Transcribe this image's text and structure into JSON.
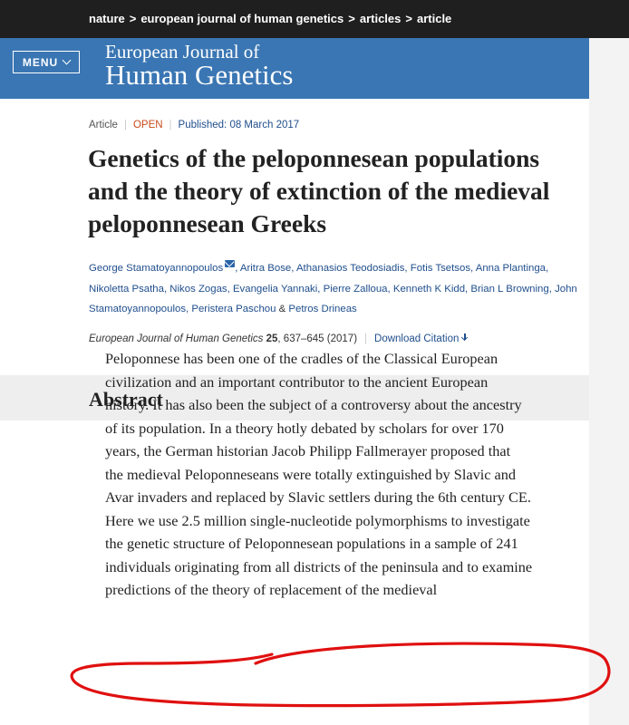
{
  "breadcrumb": {
    "items": [
      "nature",
      "european journal of human genetics",
      "articles",
      "article"
    ],
    "separator": ">"
  },
  "header": {
    "menu_label": "MENU",
    "journal_line1": "European Journal of",
    "journal_line2": "Human Genetics"
  },
  "article": {
    "type": "Article",
    "access": "OPEN",
    "published": "Published: 08 March 2017",
    "title": "Genetics of the peloponnesean populations and the theory of extinction of the medieval peloponnesean Greeks",
    "authors": [
      "George Stamatoyannopoulos",
      "Aritra Bose",
      "Athanasios Teodosiadis",
      "Fotis Tsetsos",
      "Anna Plantinga",
      "Nikoletta Psatha",
      "Nikos Zogas",
      "Evangelia Yannaki",
      "Pierre Zalloua",
      "Kenneth K Kidd",
      "Brian L Browning",
      "John Stamatoyannopoulos",
      "Peristera Paschou",
      "Petros Drineas"
    ],
    "author_sep": ", ",
    "author_last_sep": " & ",
    "citation": {
      "journal": "European Journal of Human Genetics",
      "volume": "25",
      "pages": ", 637–645 (2017)",
      "download": "Download Citation"
    }
  },
  "abstract": {
    "heading": "Abstract",
    "lines": [
      "Peloponnese has been one of the cradles of the Classical European",
      "civilization and an important contributor to the ancient European",
      "history. It has also been the subject of a controversy about the ancestry",
      "of its population. In a theory hotly debated by scholars for over 170",
      "years, the German historian Jacob Philipp Fallmerayer proposed that",
      "the medieval Peloponneseans were totally extinguished by Slavic and",
      "Avar invaders and replaced by Slavic settlers during the 6th century CE.",
      "Here we use 2.5 million single-nucleotide polymorphisms to investigate",
      "the genetic structure of Peloponnesean populations in a sample of 241",
      "individuals originating from all districts of the peninsula and to examine",
      "predictions of the theory of replacement of the medieval"
    ]
  },
  "colors": {
    "header_blue": "#3a76b3",
    "link_blue": "#1f4e8c",
    "open_orange": "#c74b1a",
    "annotation_red": "#e01010"
  },
  "icons": [
    "chevron-down-icon",
    "mail-icon",
    "download-icon"
  ]
}
